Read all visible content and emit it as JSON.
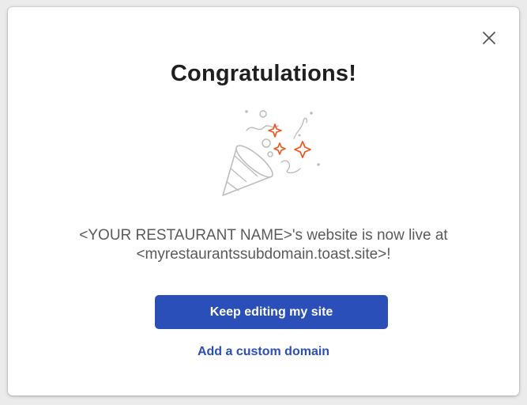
{
  "modal": {
    "title": "Congratulations!",
    "message_line1": "<YOUR RESTAURANT NAME>'s website is now live at",
    "message_line2": "<myrestaurantssubdomain.toast.site>!",
    "primary_button": "Keep editing my site",
    "secondary_link": "Add a custom domain",
    "close_icon": "close-icon",
    "illustration_icon": "party-popper-icon"
  },
  "colors": {
    "accent": "#2b4fb9",
    "confetti_orange": "#f0541e",
    "title_text": "#1f1f1f",
    "body_text": "#5a5a5a"
  }
}
